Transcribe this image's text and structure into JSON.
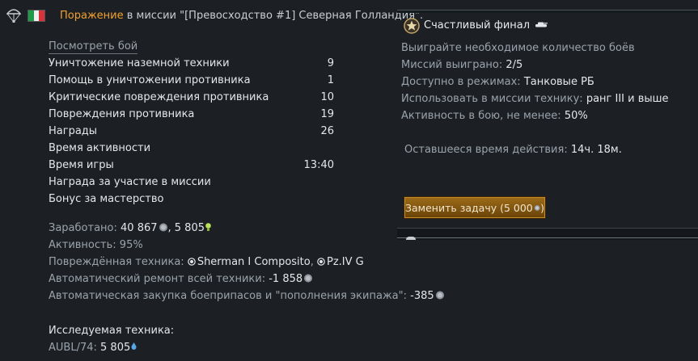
{
  "header": {
    "result": "Поражение",
    "mission_text": " в миссии \"[Превосходство #1] Северная Голландия\"."
  },
  "view_battle_label": "Посмотреть бой",
  "stats": [
    {
      "label": "Уничтожение наземной техники",
      "value": "9"
    },
    {
      "label": "Помощь в уничтожении противника",
      "value": "1"
    },
    {
      "label": "Критические повреждения противника",
      "value": "10"
    },
    {
      "label": "Повреждения противника",
      "value": "19"
    },
    {
      "label": "Награды",
      "value": "26"
    },
    {
      "label": "Время активности",
      "value": ""
    },
    {
      "label": "Время игры",
      "value": "13:40"
    },
    {
      "label": "Награда за участие в миссии",
      "value": ""
    },
    {
      "label": "Бонус за мастерство",
      "value": ""
    }
  ],
  "summary": {
    "earned_label": "Заработано:",
    "earned_lions": "40 867",
    "earned_rp": ", 5 805",
    "activity_label": "Активность:",
    "activity_value": "95%",
    "damaged_label": "Повреждённая техника:",
    "damaged_vehicle_1": "Sherman I Composito",
    "damaged_vehicle_2": "Pz.IV G",
    "repair_label": "Автоматический ремонт всей техники:",
    "repair_value": "-1 858",
    "ammo_label": "Автоматическая закупка боеприпасов и \"пополнения экипажа\":",
    "ammo_value": "-385",
    "research_label": "Исследуемая техника:",
    "research_vehicle": "AUBL/74:",
    "research_value": "5 805"
  },
  "task": {
    "title": "Счастливый финал",
    "description": "Выиграйте необходимое количество боёв",
    "won_label": "Миссий выиграно:",
    "won_value": "2/5",
    "modes_label": "Доступно в режимах:",
    "modes_value": "Танковые РБ",
    "vehicle_label": "Использовать в миссии технику:",
    "vehicle_value": "ранг III и выше",
    "activity_label": "Активность в бою, не менее:",
    "activity_value": "50%",
    "time_label": "Оставшееся время действия:",
    "time_value": "14ч. 18м.",
    "replace_label": "Заменить задачу (5 000"
  },
  "colors": {
    "background": "#1c2025",
    "defeat": "#f3a12a",
    "text_primary": "#e4e7ea",
    "text_secondary": "#9aa3ab",
    "button_accent": "#c58b2a"
  },
  "icons": [
    "parachute-icon",
    "italy-flag-icon",
    "silver-lions-icon",
    "research-points-icon",
    "mission-medal-icon",
    "tank-icon"
  ]
}
